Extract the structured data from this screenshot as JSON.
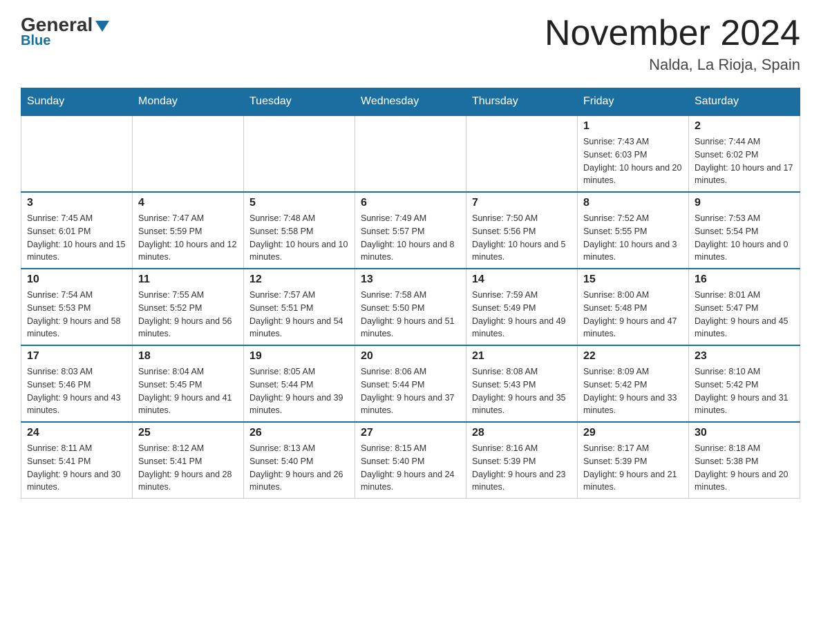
{
  "header": {
    "logo": {
      "general": "General",
      "blue": "Blue"
    },
    "title": "November 2024",
    "subtitle": "Nalda, La Rioja, Spain"
  },
  "days_of_week": [
    "Sunday",
    "Monday",
    "Tuesday",
    "Wednesday",
    "Thursday",
    "Friday",
    "Saturday"
  ],
  "weeks": [
    [
      {
        "day": "",
        "sunrise": "",
        "sunset": "",
        "daylight": ""
      },
      {
        "day": "",
        "sunrise": "",
        "sunset": "",
        "daylight": ""
      },
      {
        "day": "",
        "sunrise": "",
        "sunset": "",
        "daylight": ""
      },
      {
        "day": "",
        "sunrise": "",
        "sunset": "",
        "daylight": ""
      },
      {
        "day": "",
        "sunrise": "",
        "sunset": "",
        "daylight": ""
      },
      {
        "day": "1",
        "sunrise": "Sunrise: 7:43 AM",
        "sunset": "Sunset: 6:03 PM",
        "daylight": "Daylight: 10 hours and 20 minutes."
      },
      {
        "day": "2",
        "sunrise": "Sunrise: 7:44 AM",
        "sunset": "Sunset: 6:02 PM",
        "daylight": "Daylight: 10 hours and 17 minutes."
      }
    ],
    [
      {
        "day": "3",
        "sunrise": "Sunrise: 7:45 AM",
        "sunset": "Sunset: 6:01 PM",
        "daylight": "Daylight: 10 hours and 15 minutes."
      },
      {
        "day": "4",
        "sunrise": "Sunrise: 7:47 AM",
        "sunset": "Sunset: 5:59 PM",
        "daylight": "Daylight: 10 hours and 12 minutes."
      },
      {
        "day": "5",
        "sunrise": "Sunrise: 7:48 AM",
        "sunset": "Sunset: 5:58 PM",
        "daylight": "Daylight: 10 hours and 10 minutes."
      },
      {
        "day": "6",
        "sunrise": "Sunrise: 7:49 AM",
        "sunset": "Sunset: 5:57 PM",
        "daylight": "Daylight: 10 hours and 8 minutes."
      },
      {
        "day": "7",
        "sunrise": "Sunrise: 7:50 AM",
        "sunset": "Sunset: 5:56 PM",
        "daylight": "Daylight: 10 hours and 5 minutes."
      },
      {
        "day": "8",
        "sunrise": "Sunrise: 7:52 AM",
        "sunset": "Sunset: 5:55 PM",
        "daylight": "Daylight: 10 hours and 3 minutes."
      },
      {
        "day": "9",
        "sunrise": "Sunrise: 7:53 AM",
        "sunset": "Sunset: 5:54 PM",
        "daylight": "Daylight: 10 hours and 0 minutes."
      }
    ],
    [
      {
        "day": "10",
        "sunrise": "Sunrise: 7:54 AM",
        "sunset": "Sunset: 5:53 PM",
        "daylight": "Daylight: 9 hours and 58 minutes."
      },
      {
        "day": "11",
        "sunrise": "Sunrise: 7:55 AM",
        "sunset": "Sunset: 5:52 PM",
        "daylight": "Daylight: 9 hours and 56 minutes."
      },
      {
        "day": "12",
        "sunrise": "Sunrise: 7:57 AM",
        "sunset": "Sunset: 5:51 PM",
        "daylight": "Daylight: 9 hours and 54 minutes."
      },
      {
        "day": "13",
        "sunrise": "Sunrise: 7:58 AM",
        "sunset": "Sunset: 5:50 PM",
        "daylight": "Daylight: 9 hours and 51 minutes."
      },
      {
        "day": "14",
        "sunrise": "Sunrise: 7:59 AM",
        "sunset": "Sunset: 5:49 PM",
        "daylight": "Daylight: 9 hours and 49 minutes."
      },
      {
        "day": "15",
        "sunrise": "Sunrise: 8:00 AM",
        "sunset": "Sunset: 5:48 PM",
        "daylight": "Daylight: 9 hours and 47 minutes."
      },
      {
        "day": "16",
        "sunrise": "Sunrise: 8:01 AM",
        "sunset": "Sunset: 5:47 PM",
        "daylight": "Daylight: 9 hours and 45 minutes."
      }
    ],
    [
      {
        "day": "17",
        "sunrise": "Sunrise: 8:03 AM",
        "sunset": "Sunset: 5:46 PM",
        "daylight": "Daylight: 9 hours and 43 minutes."
      },
      {
        "day": "18",
        "sunrise": "Sunrise: 8:04 AM",
        "sunset": "Sunset: 5:45 PM",
        "daylight": "Daylight: 9 hours and 41 minutes."
      },
      {
        "day": "19",
        "sunrise": "Sunrise: 8:05 AM",
        "sunset": "Sunset: 5:44 PM",
        "daylight": "Daylight: 9 hours and 39 minutes."
      },
      {
        "day": "20",
        "sunrise": "Sunrise: 8:06 AM",
        "sunset": "Sunset: 5:44 PM",
        "daylight": "Daylight: 9 hours and 37 minutes."
      },
      {
        "day": "21",
        "sunrise": "Sunrise: 8:08 AM",
        "sunset": "Sunset: 5:43 PM",
        "daylight": "Daylight: 9 hours and 35 minutes."
      },
      {
        "day": "22",
        "sunrise": "Sunrise: 8:09 AM",
        "sunset": "Sunset: 5:42 PM",
        "daylight": "Daylight: 9 hours and 33 minutes."
      },
      {
        "day": "23",
        "sunrise": "Sunrise: 8:10 AM",
        "sunset": "Sunset: 5:42 PM",
        "daylight": "Daylight: 9 hours and 31 minutes."
      }
    ],
    [
      {
        "day": "24",
        "sunrise": "Sunrise: 8:11 AM",
        "sunset": "Sunset: 5:41 PM",
        "daylight": "Daylight: 9 hours and 30 minutes."
      },
      {
        "day": "25",
        "sunrise": "Sunrise: 8:12 AM",
        "sunset": "Sunset: 5:41 PM",
        "daylight": "Daylight: 9 hours and 28 minutes."
      },
      {
        "day": "26",
        "sunrise": "Sunrise: 8:13 AM",
        "sunset": "Sunset: 5:40 PM",
        "daylight": "Daylight: 9 hours and 26 minutes."
      },
      {
        "day": "27",
        "sunrise": "Sunrise: 8:15 AM",
        "sunset": "Sunset: 5:40 PM",
        "daylight": "Daylight: 9 hours and 24 minutes."
      },
      {
        "day": "28",
        "sunrise": "Sunrise: 8:16 AM",
        "sunset": "Sunset: 5:39 PM",
        "daylight": "Daylight: 9 hours and 23 minutes."
      },
      {
        "day": "29",
        "sunrise": "Sunrise: 8:17 AM",
        "sunset": "Sunset: 5:39 PM",
        "daylight": "Daylight: 9 hours and 21 minutes."
      },
      {
        "day": "30",
        "sunrise": "Sunrise: 8:18 AM",
        "sunset": "Sunset: 5:38 PM",
        "daylight": "Daylight: 9 hours and 20 minutes."
      }
    ]
  ]
}
